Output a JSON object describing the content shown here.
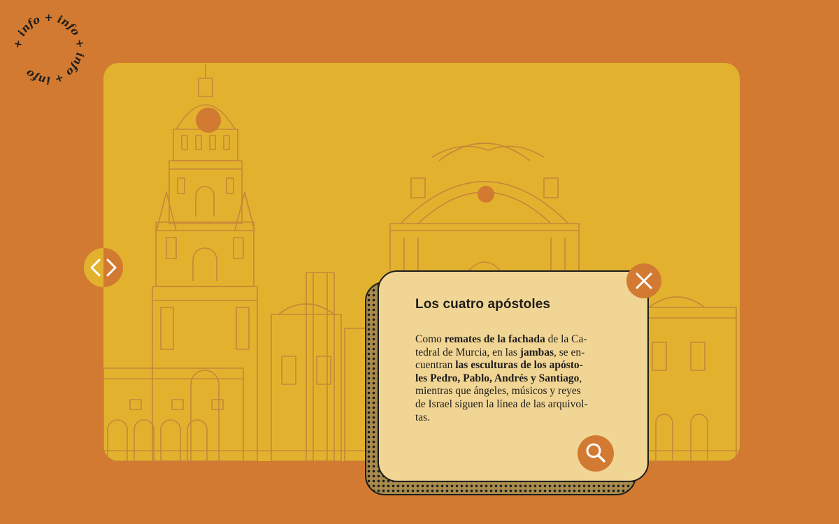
{
  "badge": {
    "text": "+ info + info + info + info "
  },
  "popup": {
    "title": "Los cuatro apóstoles",
    "lines": [
      [
        {
          "t": "Como "
        },
        {
          "t": "remates de la fachada",
          "b": true
        },
        {
          "t": " de la Ca-"
        }
      ],
      [
        {
          "t": "tedral de Murcia, en las "
        },
        {
          "t": "jambas",
          "b": true
        },
        {
          "t": ", se en-"
        }
      ],
      [
        {
          "t": "cuentran "
        },
        {
          "t": "las esculturas de los apósto-",
          "b": true
        }
      ],
      [
        {
          "t": "les Pedro, Pablo, Andrés y Santiago",
          "b": true
        },
        {
          "t": ","
        }
      ],
      [
        {
          "t": "mientras que ángeles, músicos y reyes"
        }
      ],
      [
        {
          "t": "de Israel siguen la línea de las arquivol-"
        }
      ],
      [
        {
          "t": "tas."
        }
      ]
    ]
  },
  "icons": {
    "close": "close-icon",
    "zoom": "magnifier-icon",
    "prev": "chevron-left-icon",
    "next": "chevron-right-icon"
  },
  "colors": {
    "background": "#d27a31",
    "stage": "#e2b22e",
    "line_art": "#c7863a",
    "popup": "#f1d594",
    "accent": "#d27a31",
    "ink": "#1d1d1b"
  }
}
